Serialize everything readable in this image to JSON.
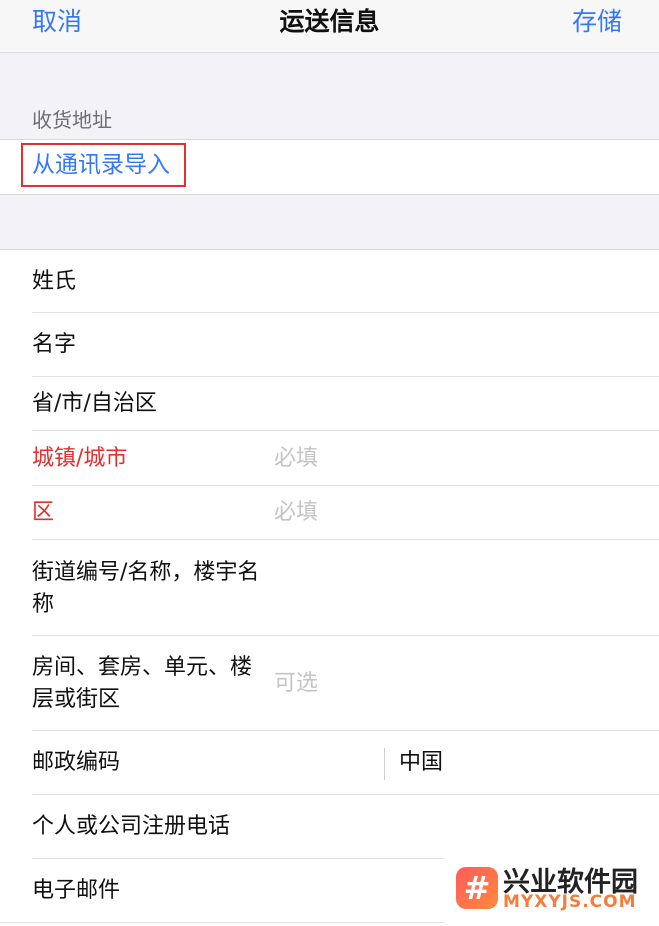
{
  "nav": {
    "cancel": "取消",
    "title": "运送信息",
    "save": "存储"
  },
  "section": {
    "header": "收货地址",
    "import_link": "从通讯录导入"
  },
  "form": {
    "rows": [
      {
        "label": "姓氏",
        "placeholder": ""
      },
      {
        "label": "名字",
        "placeholder": ""
      },
      {
        "label": "省/市/自治区",
        "placeholder": ""
      },
      {
        "label": "城镇/城市",
        "placeholder": "必填"
      },
      {
        "label": "区",
        "placeholder": "必填"
      },
      {
        "label": "街道编号/名称，楼宇名称",
        "placeholder": ""
      },
      {
        "label": "房间、套房、单元、楼层或街区",
        "placeholder": "可选"
      },
      {
        "label": "邮政编码",
        "placeholder": "",
        "country": "中国"
      },
      {
        "label": "个人或公司注册电话",
        "placeholder": ""
      },
      {
        "label": "电子邮件",
        "placeholder": ""
      }
    ]
  },
  "watermark": {
    "icon": "#",
    "cn": "兴业软件园",
    "en": "MYXYJS.COM"
  },
  "colors": {
    "accent": "#3478f6",
    "required": "#e0312e",
    "highlight_border": "#e0312e"
  }
}
